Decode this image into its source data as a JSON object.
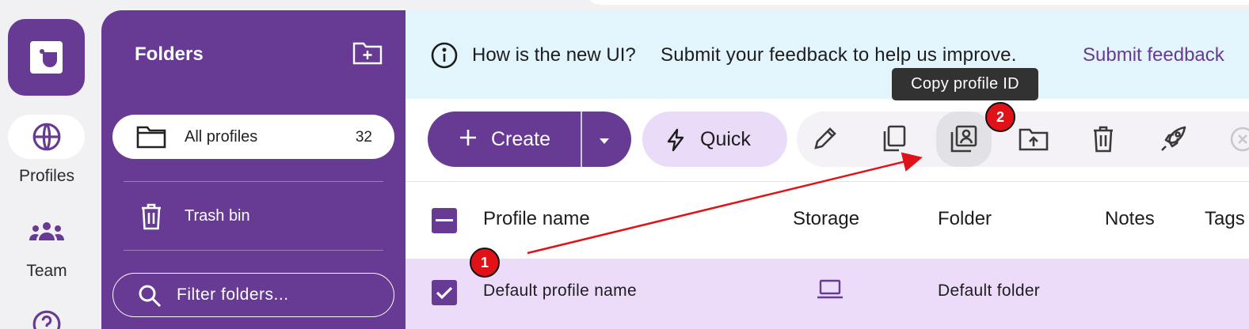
{
  "rail": {
    "items": [
      {
        "label": "Profiles",
        "icon": "globe-icon",
        "active": true
      },
      {
        "label": "Team",
        "icon": "team-icon",
        "active": false
      },
      {
        "label": "",
        "icon": "help-icon",
        "active": false
      }
    ]
  },
  "folders": {
    "title": "Folders",
    "items": [
      {
        "label": "All profiles",
        "count": "32",
        "icon": "folder-icon",
        "selected": true
      },
      {
        "label": "Trash bin",
        "count": "",
        "icon": "trash-icon",
        "selected": false
      }
    ],
    "filter_placeholder": "Filter folders..."
  },
  "banner": {
    "question": "How is the new UI?",
    "message": "Submit your feedback to help us improve.",
    "link": "Submit feedback"
  },
  "toolbar": {
    "create_label": "Create",
    "quick_label": "Quick",
    "icons": [
      "edit-icon",
      "copy-icon",
      "copy-profile-id-icon",
      "move-to-folder-icon",
      "delete-icon",
      "launch-icon",
      "close-icon"
    ],
    "tooltip": "Copy profile ID"
  },
  "table": {
    "columns": [
      "Profile name",
      "Storage",
      "Folder",
      "Notes",
      "Tags"
    ],
    "rows": [
      {
        "name": "Default profile name",
        "storage": "laptop-icon",
        "folder": "Default folder",
        "notes": "",
        "tags": "",
        "checked": true
      }
    ]
  },
  "annotations": [
    {
      "label": "1"
    },
    {
      "label": "2"
    }
  ],
  "colors": {
    "brand": "#673a94",
    "banner_bg": "#e3f5fc",
    "selected_row": "#ecdcfa",
    "quick_bg": "#eadcf8",
    "annotation": "#e01218"
  }
}
